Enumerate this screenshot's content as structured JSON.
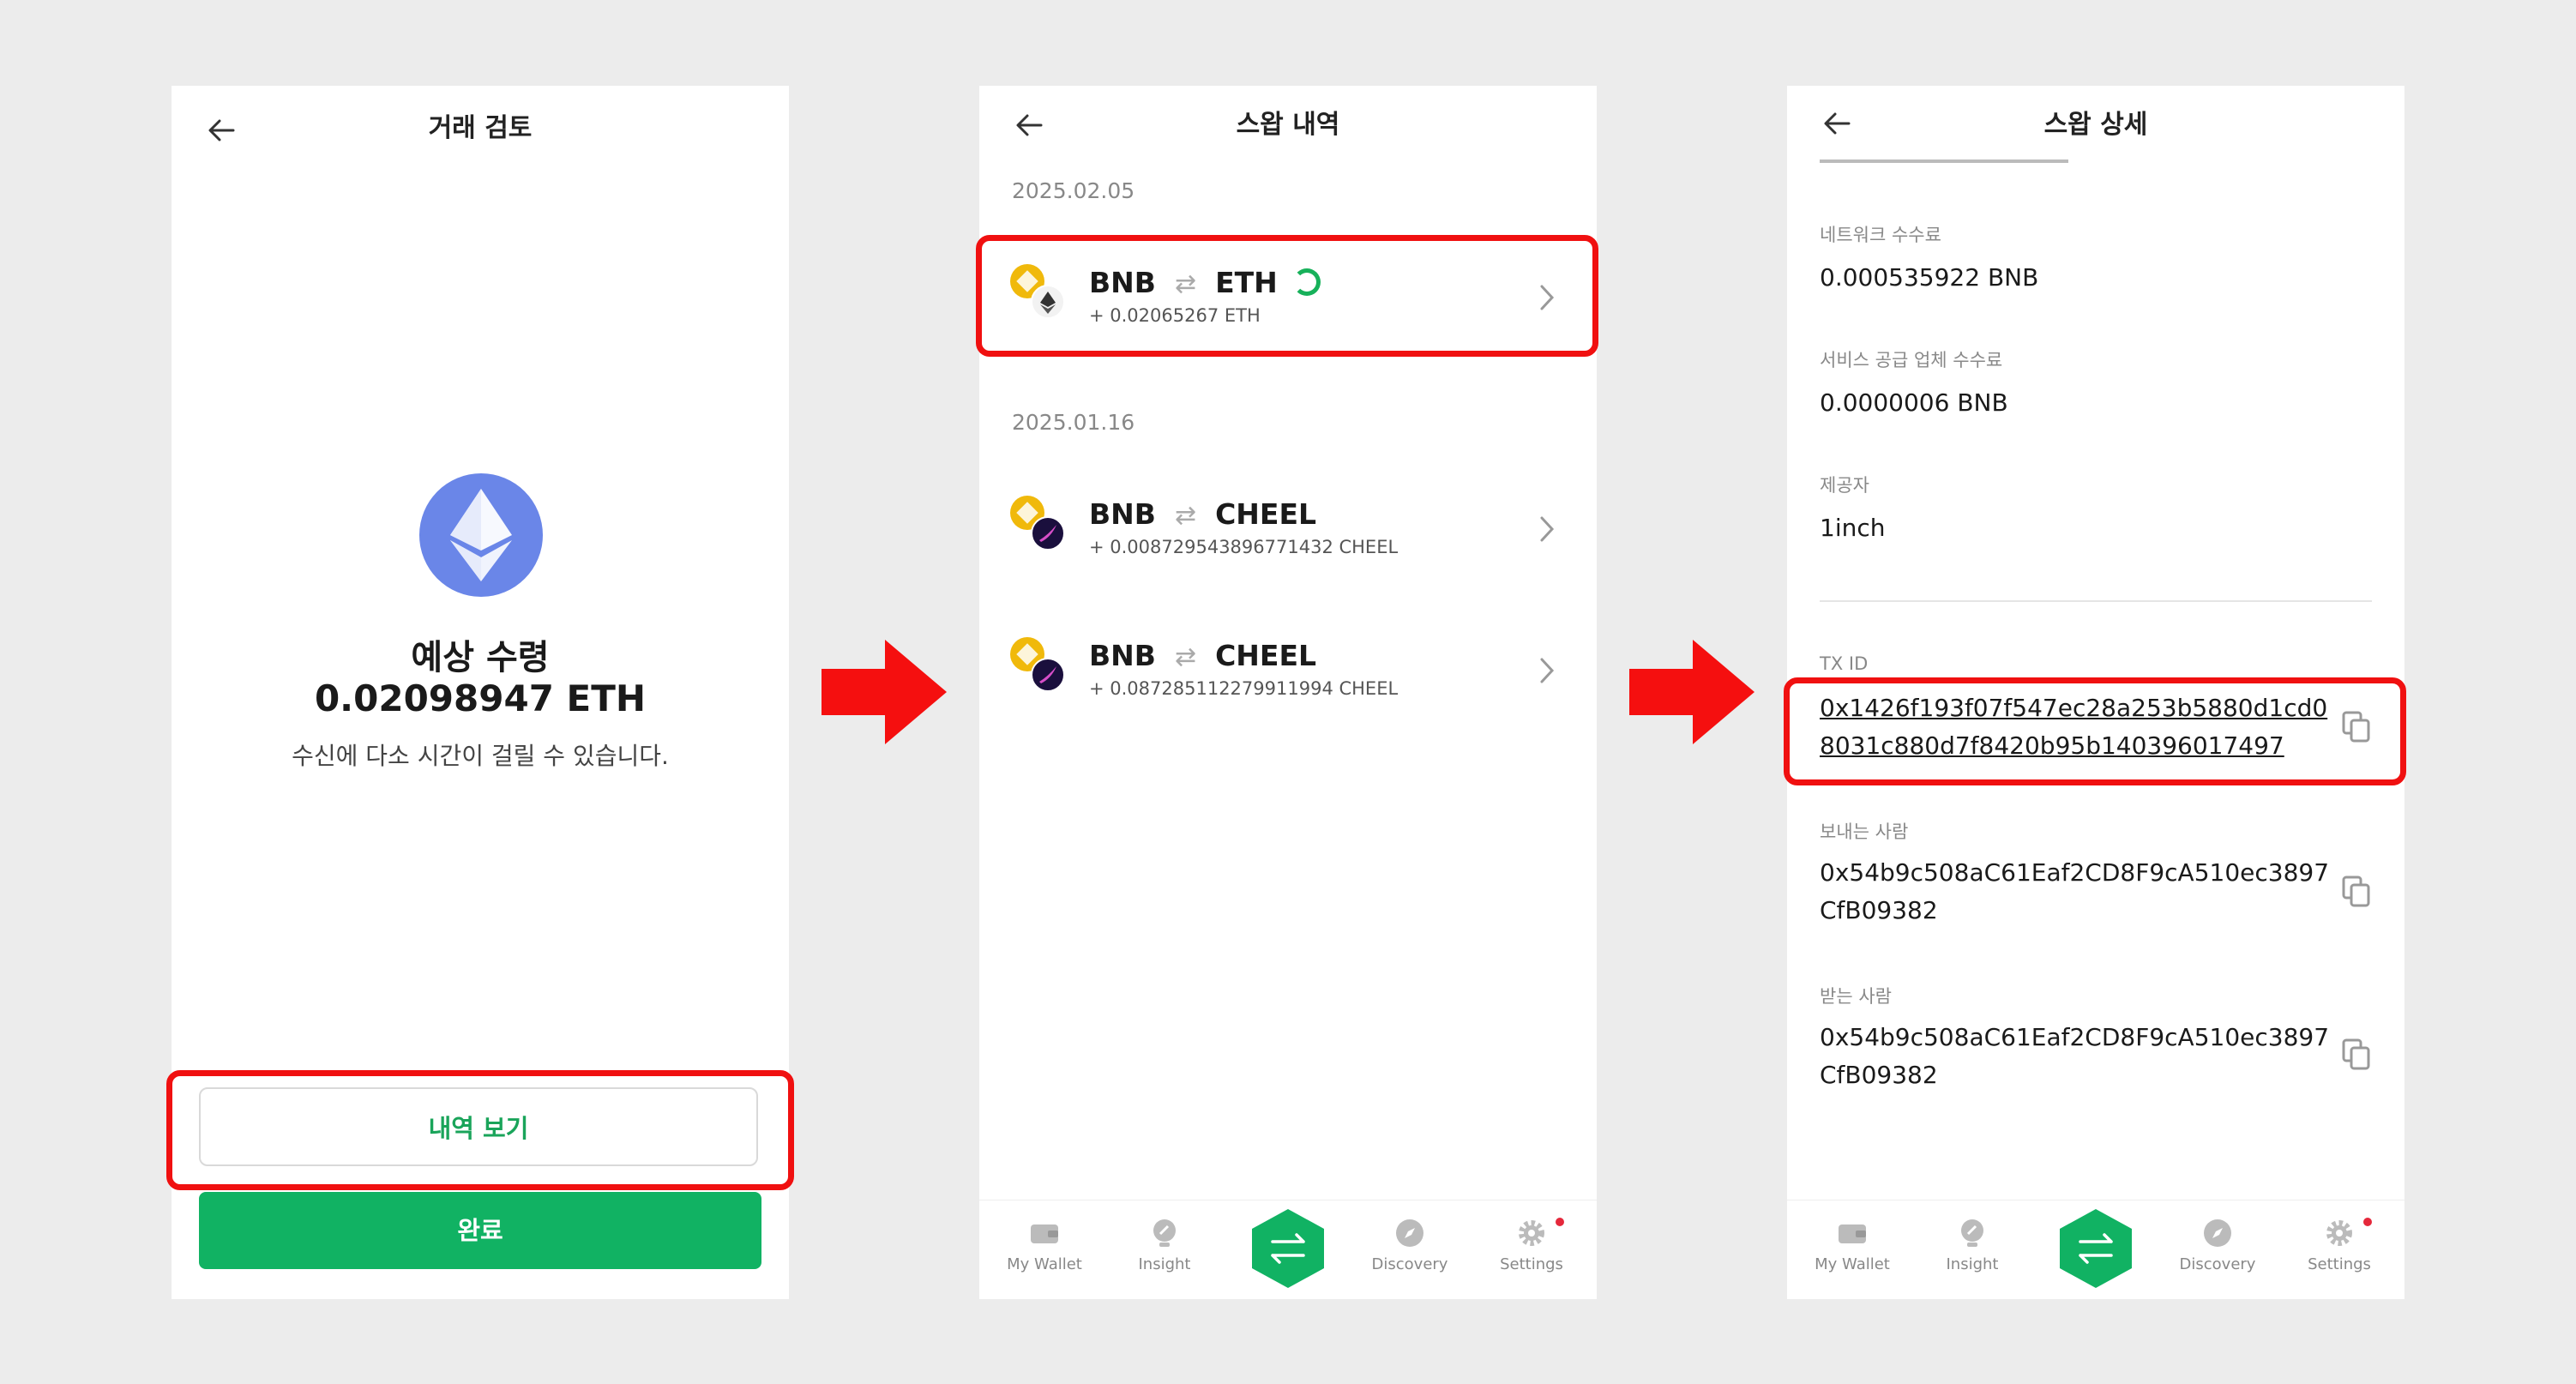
{
  "colors": {
    "accent_green": "#11b263",
    "highlight_red": "#f01010",
    "eth_blue": "#6a86e8"
  },
  "screen1": {
    "title": "거래 검토",
    "icon": "eth-icon",
    "estimate_label": "예상 수령",
    "estimate_amount": "0.02098947 ETH",
    "note": "수신에 다소 시간이 걸릴 수 있습니다.",
    "history_button": "내역 보기",
    "done_button": "완료"
  },
  "screen2": {
    "title": "스왑 내역",
    "groups": [
      {
        "date": "2025.02.05",
        "items": [
          {
            "from": "BNB",
            "to": "ETH",
            "amount": "+ 0.02065267 ETH",
            "status": "pending"
          }
        ]
      },
      {
        "date": "2025.01.16",
        "items": [
          {
            "from": "BNB",
            "to": "CHEEL",
            "amount": "+ 0.008729543896771432 CHEEL"
          },
          {
            "from": "BNB",
            "to": "CHEEL",
            "amount": "+ 0.087285112279911994 CHEEL"
          }
        ]
      }
    ],
    "swap_arrow": "⇄"
  },
  "tabbar": {
    "tabs": [
      "My Wallet",
      "Insight",
      "Discovery",
      "Settings"
    ],
    "center": "swap-icon"
  },
  "screen3": {
    "title": "스왑 상세",
    "network_fee_label": "네트워크 수수료",
    "network_fee_value": "0.000535922 BNB",
    "service_fee_label": "서비스 공급 업체 수수료",
    "service_fee_value": "0.0000006 BNB",
    "provider_label": "제공자",
    "provider_value": "1inch",
    "txid_label": "TX ID",
    "txid_line1": "0x1426f193f07f547ec28a253b5880d1cd0",
    "txid_line2": "8031c880d7f8420b95b140396017497",
    "sender_label": "보내는 사람",
    "sender_line1": "0x54b9c508aC61Eaf2CD8F9cA510ec3897",
    "sender_line2": "CfB09382",
    "receiver_label": "받는 사람",
    "receiver_line1": "0x54b9c508aC61Eaf2CD8F9cA510ec3897",
    "receiver_line2": "CfB09382"
  }
}
